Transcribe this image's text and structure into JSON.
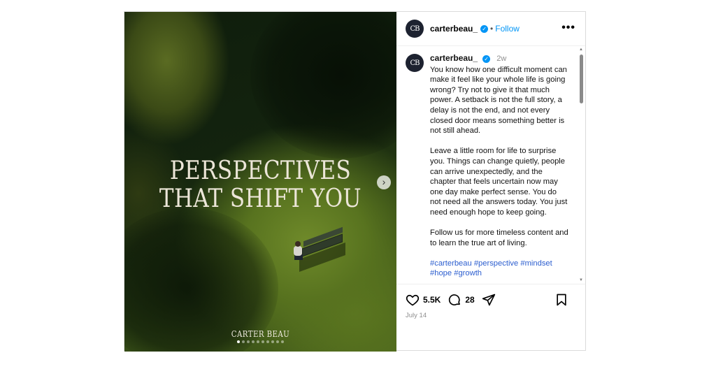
{
  "media": {
    "headline_line1": "PERSPECTIVES",
    "headline_line2": "THAT SHIFT YOU",
    "brand": "CARTER BEAU",
    "slide_count": 10,
    "active_slide": 1,
    "next_icon": "chevron-right-icon"
  },
  "header": {
    "avatar_initials": "CB",
    "username": "carterbeau_",
    "separator": "•",
    "follow_label": "Follow",
    "more_label": "•••"
  },
  "caption": {
    "avatar_initials": "CB",
    "username": "carterbeau_",
    "time": "2w",
    "paragraph1": "You know how one difficult moment can make it feel like your whole life is going wrong? Try not to give it that much power. A setback is not the full story, a delay is not the end, and not every closed door means something better is not still ahead.",
    "paragraph2": "Leave a little room for life to surprise you. Things can change quietly, people can arrive unexpectedly, and the chapter that feels uncertain now may one day make perfect sense. You do not need all the answers today. You just need enough hope to keep going.",
    "paragraph3": "Follow us for more timeless content and to learn the true art of living.",
    "hashtags_line1": "#carterbeau #perspective #mindset",
    "hashtags_line2": "#hope #growth"
  },
  "actions": {
    "likes": "5.5K",
    "comments": "28",
    "icons": [
      "heart-icon",
      "comment-icon",
      "share-icon",
      "bookmark-icon"
    ]
  },
  "date": "July 14",
  "colors": {
    "accent": "#0095f6",
    "hashtag": "#2c5ecf",
    "muted": "#8e8e8e"
  }
}
